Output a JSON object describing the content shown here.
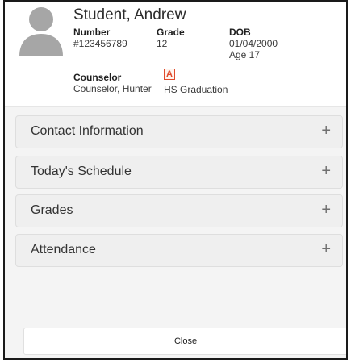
{
  "student": {
    "name": "Student, Andrew",
    "number_label": "Number",
    "number_value": "#123456789",
    "grade_label": "Grade",
    "grade_value": "12",
    "dob_label": "DOB",
    "dob_value": "01/04/2000",
    "age": "Age 17",
    "counselor_label": "Counselor",
    "counselor_value": "Counselor, Hunter",
    "graduation_icon_glyph": "A",
    "graduation_label": "HS Graduation"
  },
  "sections": [
    {
      "title": "Contact Information",
      "toggle": "+"
    },
    {
      "title": "Today's Schedule",
      "toggle": "+"
    },
    {
      "title": "Grades",
      "toggle": "+"
    },
    {
      "title": "Attendance",
      "toggle": "+"
    }
  ],
  "footer": {
    "close_label": "Close"
  },
  "icons": {
    "avatar": "person-silhouette-icon",
    "graduation": "graduation-flag-icon",
    "expand": "plus-icon"
  },
  "colors": {
    "avatar": "#a6a6a6",
    "graduation_icon": "#e04a2b",
    "panel_background": "#f4f4f4",
    "section_background": "#efefef"
  }
}
